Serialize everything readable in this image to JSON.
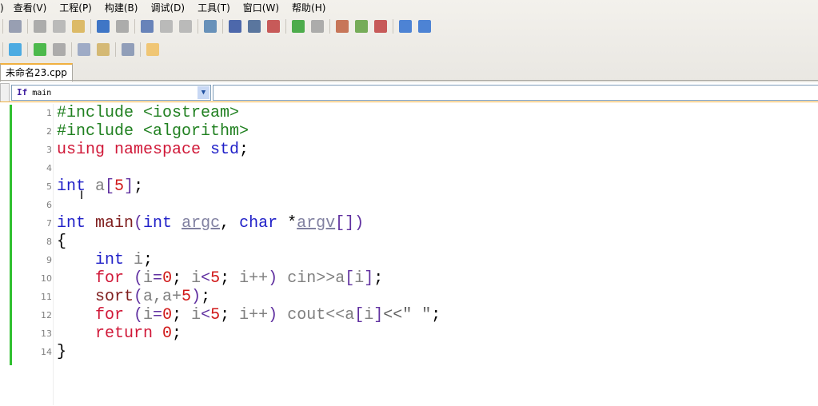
{
  "menu": [
    "查看(V)",
    "工程(P)",
    "构建(B)",
    "调试(D)",
    "工具(T)",
    "窗口(W)",
    "帮助(H)"
  ],
  "menu_prefix": ")",
  "toolbar1": [
    "print-icon",
    "cut-icon",
    "copy-icon",
    "paste-icon",
    "undo-icon",
    "redo-icon",
    "find-icon",
    "find-next-icon",
    "replace-icon",
    "goto-icon",
    "bookmark-icon",
    "toggle-comment-icon",
    "uncomment-icon",
    "back-icon",
    "forward-icon",
    "new-project-icon",
    "add-file-icon",
    "close-file-icon",
    "help-icon",
    "about-icon"
  ],
  "toolbar2": [
    "rebuild-icon",
    "run-icon",
    "stop-icon",
    "compile-file-icon",
    "compile-project-icon",
    "view-log-icon",
    "hand-icon"
  ],
  "tab": {
    "label": "未命名23.cpp"
  },
  "function_combo": {
    "value": "main",
    "icon": "function-icon"
  },
  "code": [
    [
      [
        "#include <iostream>",
        "pp"
      ]
    ],
    [
      [
        "#include <algorithm>",
        "pp"
      ]
    ],
    [
      [
        "using namespace ",
        "kr"
      ],
      [
        "std",
        "kw"
      ],
      [
        ";",
        "pu"
      ]
    ],
    [],
    [
      [
        "int",
        "kw"
      ],
      [
        " a",
        "id"
      ],
      [
        "[",
        "op"
      ],
      [
        "5",
        "num"
      ],
      [
        "]",
        "op"
      ],
      [
        ";",
        "pu"
      ]
    ],
    [],
    [
      [
        "int",
        "kw"
      ],
      [
        " main",
        "fn"
      ],
      [
        "(",
        "op"
      ],
      [
        "int",
        "kw"
      ],
      [
        " ",
        "id"
      ],
      [
        "argc",
        "pr"
      ],
      [
        ", ",
        "pu"
      ],
      [
        "char",
        "kw"
      ],
      [
        " *",
        "pu"
      ],
      [
        "argv",
        "pr"
      ],
      [
        "[])",
        "op"
      ]
    ],
    [
      [
        "{",
        "pu"
      ]
    ],
    [
      [
        "    int",
        "kw"
      ],
      [
        " i",
        "id"
      ],
      [
        ";",
        "pu"
      ]
    ],
    [
      [
        "    for",
        "kr"
      ],
      [
        " (",
        "op"
      ],
      [
        "i",
        "id"
      ],
      [
        "=",
        "op"
      ],
      [
        "0",
        "num"
      ],
      [
        "; ",
        "pu"
      ],
      [
        "i",
        "id"
      ],
      [
        "<",
        "op"
      ],
      [
        "5",
        "num"
      ],
      [
        "; ",
        "pu"
      ],
      [
        "i++",
        "id"
      ],
      [
        ") ",
        "op"
      ],
      [
        "cin>>a",
        "id"
      ],
      [
        "[",
        "op"
      ],
      [
        "i",
        "id"
      ],
      [
        "]",
        "op"
      ],
      [
        ";",
        "pu"
      ]
    ],
    [
      [
        "    sort",
        "fn"
      ],
      [
        "(",
        "op"
      ],
      [
        "a,a+",
        "id"
      ],
      [
        "5",
        "num"
      ],
      [
        ")",
        "op"
      ],
      [
        ";",
        "pu"
      ]
    ],
    [
      [
        "    for",
        "kr"
      ],
      [
        " (",
        "op"
      ],
      [
        "i",
        "id"
      ],
      [
        "=",
        "op"
      ],
      [
        "0",
        "num"
      ],
      [
        "; ",
        "pu"
      ],
      [
        "i",
        "id"
      ],
      [
        "<",
        "op"
      ],
      [
        "5",
        "num"
      ],
      [
        "; ",
        "pu"
      ],
      [
        "i++",
        "id"
      ],
      [
        ") ",
        "op"
      ],
      [
        "cout<<a",
        "id"
      ],
      [
        "[",
        "op"
      ],
      [
        "i",
        "id"
      ],
      [
        "]",
        "op"
      ],
      [
        "<<\" \"",
        "st"
      ],
      [
        ";",
        "pu"
      ]
    ],
    [
      [
        "    return",
        "kr"
      ],
      [
        " 0",
        "num"
      ],
      [
        ";",
        "pu"
      ]
    ],
    [
      [
        "}",
        "pu"
      ]
    ]
  ],
  "colors": {
    "accent_tab": "#f0b040",
    "modified_bar": "#30c030"
  }
}
